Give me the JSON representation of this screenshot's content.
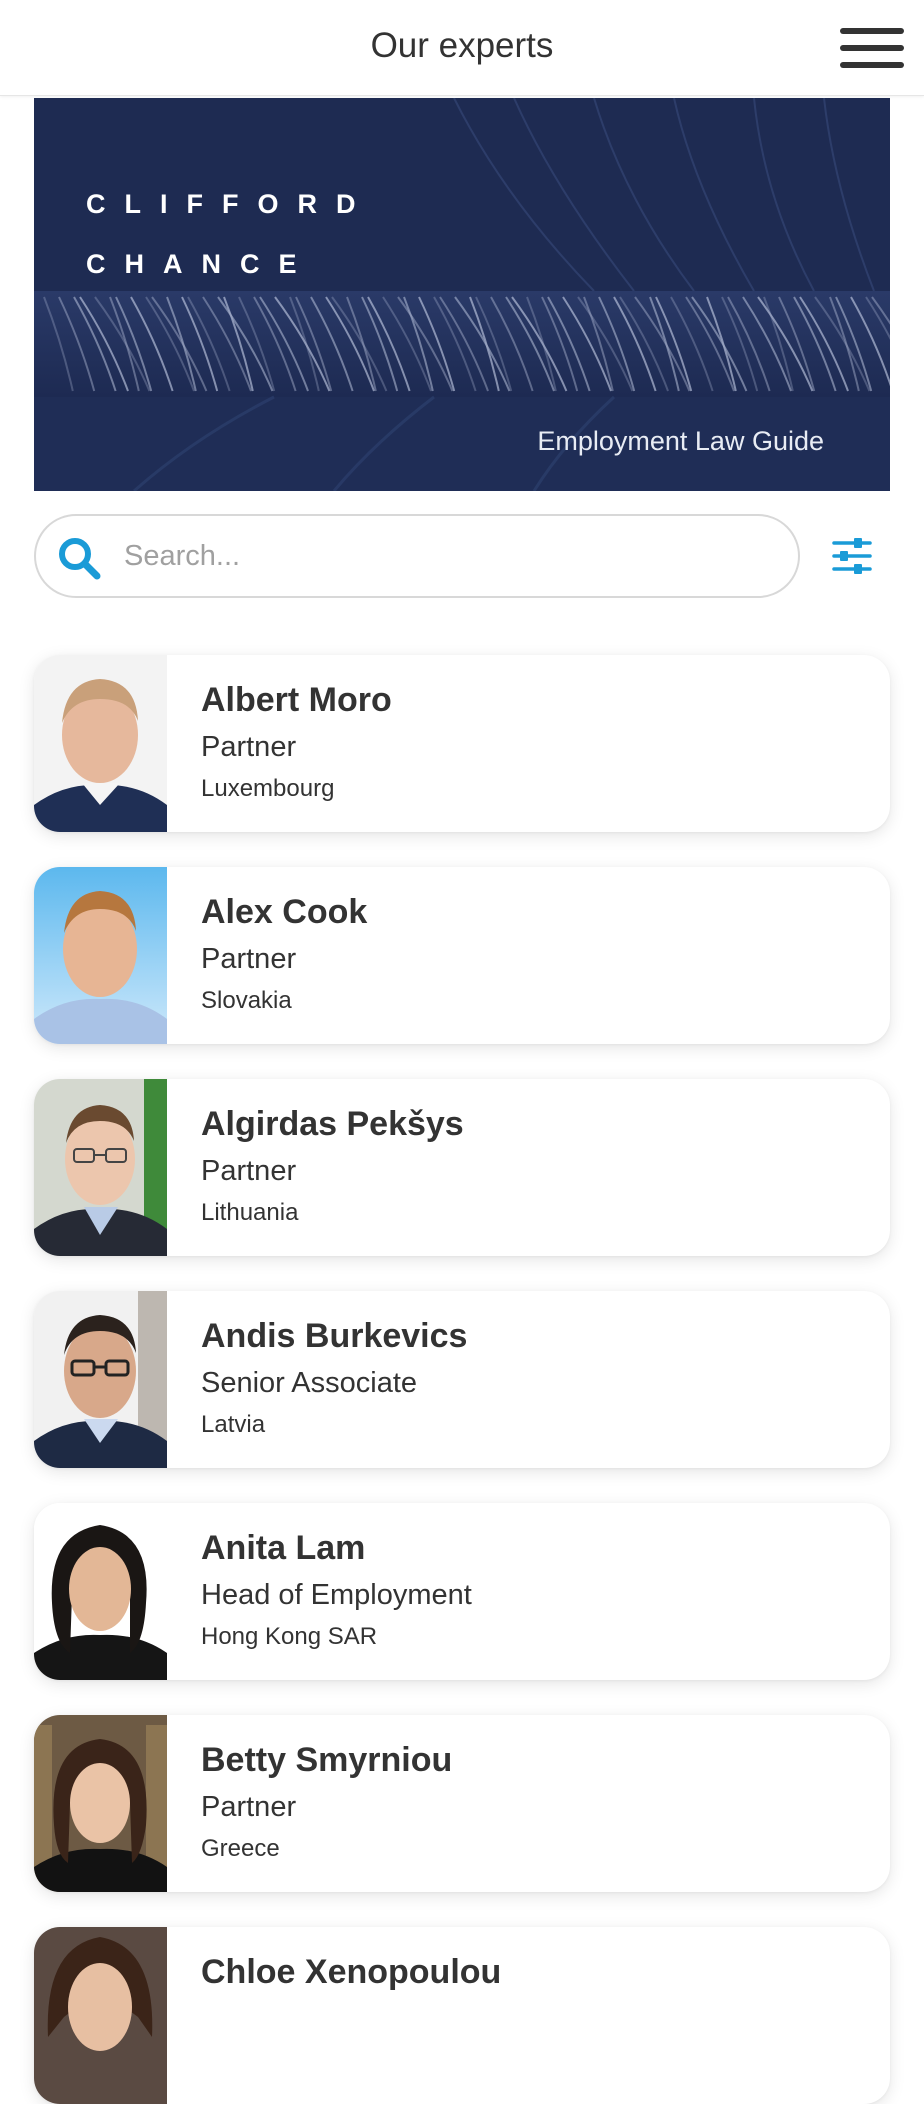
{
  "header": {
    "title": "Our experts",
    "menu_icon": "hamburger-menu-icon"
  },
  "banner": {
    "brand_line1": "CLIFFORD",
    "brand_line2": "CHANCE",
    "caption": "Employment Law Guide"
  },
  "search": {
    "placeholder": "Search...",
    "value": "",
    "icon": "search-icon",
    "filter_icon": "filter-sliders-icon"
  },
  "colors": {
    "accent": "#1a9bd7",
    "text": "#333333",
    "banner_bg": "#1f2c52"
  },
  "experts": [
    {
      "name": "Albert Moro",
      "role": "Partner",
      "location": "Luxembourg"
    },
    {
      "name": "Alex Cook",
      "role": "Partner",
      "location": "Slovakia"
    },
    {
      "name": "Algirdas Pekšys",
      "role": "Partner",
      "location": "Lithuania"
    },
    {
      "name": "Andis Burkevics",
      "role": "Senior Associate",
      "location": "Latvia"
    },
    {
      "name": "Anita Lam",
      "role": "Head of Employment",
      "location": "Hong Kong SAR"
    },
    {
      "name": "Betty Smyrniou",
      "role": "Partner",
      "location": "Greece"
    },
    {
      "name": "Chloe Xenopoulou",
      "role": "",
      "location": ""
    }
  ]
}
